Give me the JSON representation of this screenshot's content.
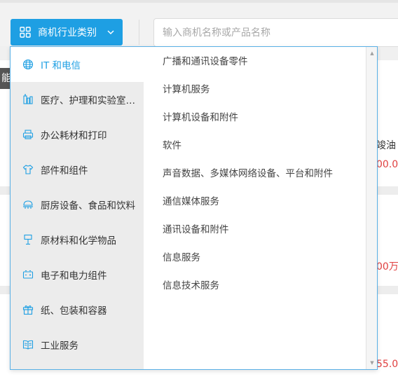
{
  "header": {
    "category_button_label": "商机行业类别",
    "search_placeholder": "输入商机名称或产品名称"
  },
  "background": {
    "badge_text": "能",
    "snippets": [
      "竣油",
      "00.0",
      "00万",
      "55.0"
    ]
  },
  "categories": [
    {
      "label": "IT 和电信",
      "icon": "globe-icon",
      "active": true
    },
    {
      "label": "医疗、护理和实验室设备",
      "icon": "medical-icon",
      "active": false
    },
    {
      "label": "办公耗材和打印",
      "icon": "printer-icon",
      "active": false
    },
    {
      "label": "部件和组件",
      "icon": "shirt-icon",
      "active": false
    },
    {
      "label": "厨房设备、食品和饮料",
      "icon": "kitchen-icon",
      "active": false
    },
    {
      "label": "原材料和化学物品",
      "icon": "flask-icon",
      "active": false
    },
    {
      "label": "电子和电力组件",
      "icon": "battery-icon",
      "active": false
    },
    {
      "label": "纸、包装和容器",
      "icon": "gift-icon",
      "active": false
    },
    {
      "label": "工业服务",
      "icon": "book-icon",
      "active": false
    }
  ],
  "subcategories": [
    "广播和通讯设备零件",
    "计算机服务",
    "计算机设备和附件",
    "软件",
    "声音数据、多媒体网络设备、平台和附件",
    "通信媒体服务",
    "通讯设备和附件",
    "信息服务",
    "信息技术服务"
  ],
  "colors": {
    "accent": "#1e9fe3",
    "left_panel_bg": "#ececec",
    "dropdown_border": "#59b0e6",
    "price_red": "#e04040"
  }
}
